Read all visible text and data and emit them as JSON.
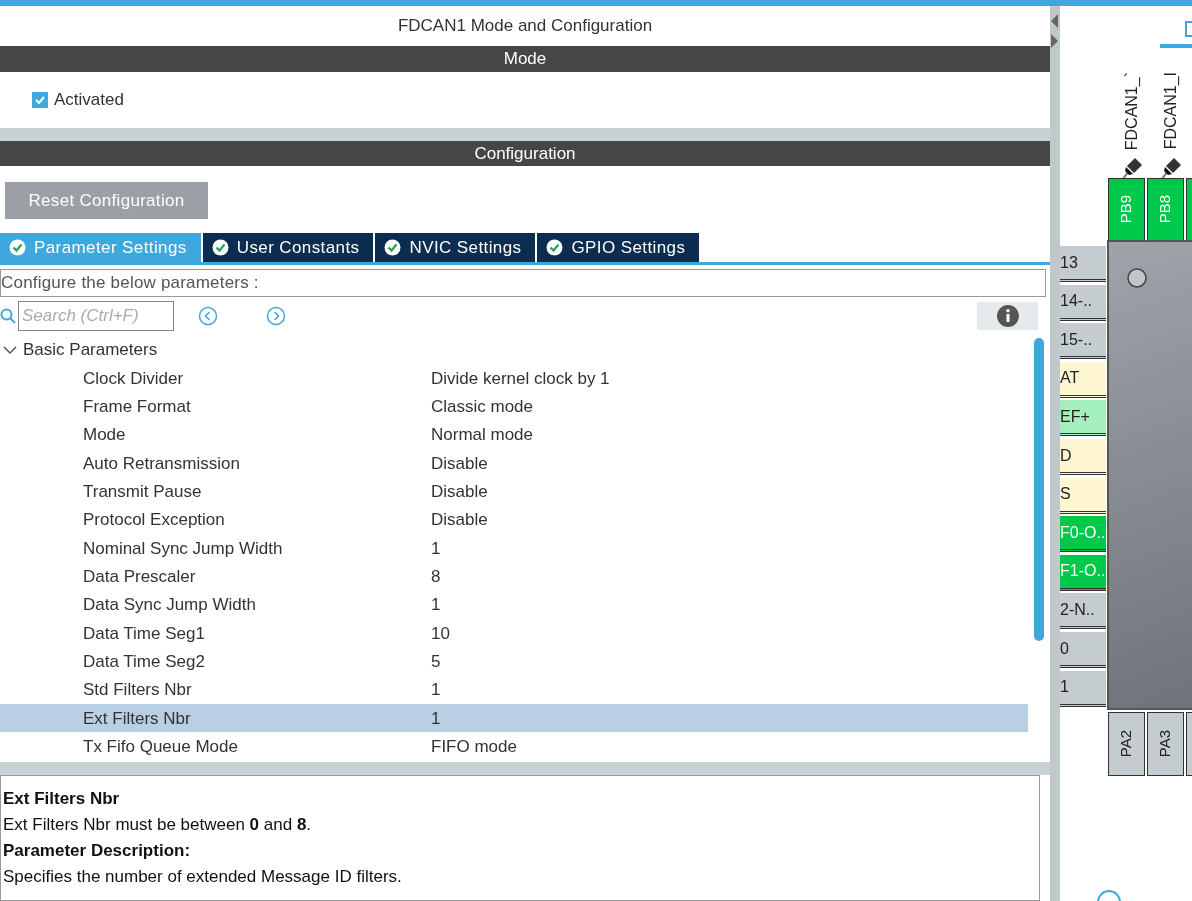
{
  "window": {
    "title": "FDCAN1 Mode and Configuration"
  },
  "mode": {
    "header": "Mode",
    "activated": {
      "label": "Activated",
      "checked": true
    }
  },
  "configuration": {
    "header": "Configuration",
    "reset_button": "Reset Configuration",
    "tabs": [
      {
        "label": "Parameter Settings",
        "selected": true
      },
      {
        "label": "User Constants",
        "selected": false
      },
      {
        "label": "NVIC Settings",
        "selected": false
      },
      {
        "label": "GPIO Settings",
        "selected": false
      }
    ],
    "hint": "Configure the below parameters :",
    "search": {
      "placeholder": "Search (Ctrl+F)"
    },
    "tree": [
      {
        "label": "Basic Parameters",
        "expanded": true,
        "children": [
          {
            "name": "Clock Divider",
            "value": "Divide kernel clock by 1",
            "selected": false
          },
          {
            "name": "Frame Format",
            "value": "Classic mode",
            "selected": false
          },
          {
            "name": "Mode",
            "value": "Normal mode",
            "selected": false
          },
          {
            "name": "Auto Retransmission",
            "value": "Disable",
            "selected": false
          },
          {
            "name": "Transmit Pause",
            "value": "Disable",
            "selected": false
          },
          {
            "name": "Protocol Exception",
            "value": "Disable",
            "selected": false
          },
          {
            "name": "Nominal Sync Jump Width",
            "value": "1",
            "selected": false
          },
          {
            "name": "Data Prescaler",
            "value": "8",
            "selected": false
          },
          {
            "name": "Data Sync Jump Width",
            "value": "1",
            "selected": false
          },
          {
            "name": "Data Time Seg1",
            "value": "10",
            "selected": false
          },
          {
            "name": "Data Time Seg2",
            "value": "5",
            "selected": false
          },
          {
            "name": "Std Filters Nbr",
            "value": "1",
            "selected": false
          },
          {
            "name": "Ext Filters Nbr",
            "value": "1",
            "selected": true
          },
          {
            "name": "Tx Fifo Queue Mode",
            "value": "FIFO mode",
            "selected": false
          }
        ]
      }
    ],
    "description": {
      "title": "Ext Filters Nbr",
      "rule": "Ext Filters Nbr must be between **0** and **8**.",
      "heading": "Parameter Description:",
      "text": "Specifies the number of extended Message ID filters."
    }
  },
  "pinout": {
    "top_pins": [
      {
        "label": "PB9",
        "signal": "FDCAN1_`",
        "color": "#00c84a"
      },
      {
        "label": "PB8",
        "signal": "FDCAN1_I",
        "color": "#00c84a"
      },
      {
        "color": "#00c84a"
      }
    ],
    "left_pins": [
      {
        "label": "13",
        "color": "#c4ccd0"
      },
      {
        "label": "14-..",
        "color": "#c4ccd0"
      },
      {
        "label": "15-..",
        "color": "#c4ccd0"
      },
      {
        "label": "AT",
        "color": "#fff6d2"
      },
      {
        "label": "EF+",
        "color": "#a4f0bc"
      },
      {
        "label": "D",
        "color": "#fff6d2"
      },
      {
        "label": "S",
        "color": "#fff6d2"
      },
      {
        "label": "F0-O..",
        "color": "#00c84a"
      },
      {
        "label": "F1-O..",
        "color": "#00c84a"
      },
      {
        "label": "2-N..",
        "color": "#c4ccd0"
      },
      {
        "label": "0",
        "color": "#c4ccd0"
      },
      {
        "label": "1",
        "color": "#c4ccd0"
      }
    ],
    "bottom_pins": [
      {
        "label": "PA2",
        "color": "#c4ccd0"
      },
      {
        "label": "PA3",
        "color": "#c4ccd0"
      },
      {
        "color": "#c4ccd0"
      }
    ]
  }
}
